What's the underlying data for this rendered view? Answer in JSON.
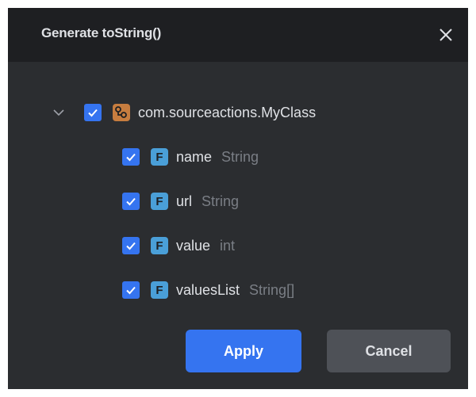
{
  "dialog": {
    "title": "Generate toString()",
    "close_icon": "close-icon"
  },
  "tree": {
    "root": {
      "label": "com.sourceactions.MyClass",
      "expanded": true,
      "checked": true,
      "icon": "class-icon"
    },
    "fields": [
      {
        "name": "name",
        "type": "String",
        "checked": true,
        "icon_letter": "F"
      },
      {
        "name": "url",
        "type": "String",
        "checked": true,
        "icon_letter": "F"
      },
      {
        "name": "value",
        "type": "int",
        "checked": true,
        "icon_letter": "F"
      },
      {
        "name": "valuesList",
        "type": "String[]",
        "checked": true,
        "icon_letter": "F"
      }
    ]
  },
  "buttons": {
    "apply": "Apply",
    "cancel": "Cancel"
  },
  "colors": {
    "accent": "#3574f0",
    "background": "#2b2d30",
    "header": "#1e1f22",
    "class_icon": "#c77d3f",
    "field_icon": "#4a9fd8"
  }
}
